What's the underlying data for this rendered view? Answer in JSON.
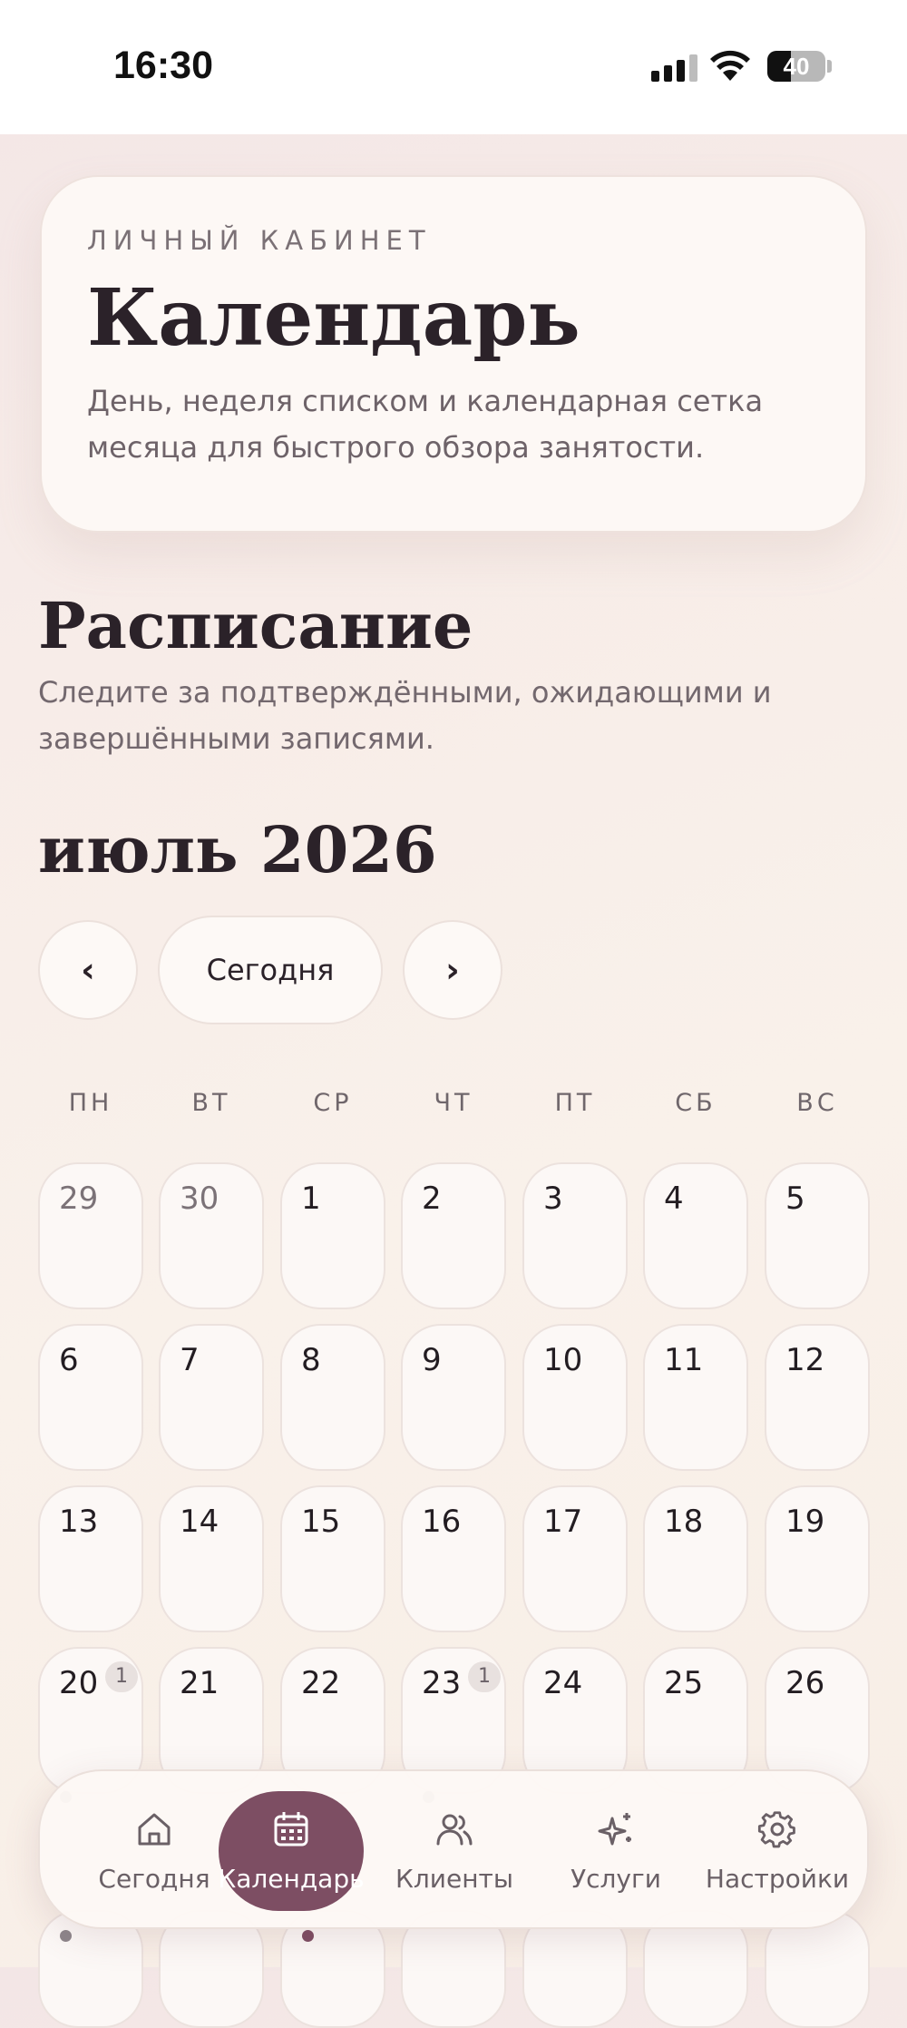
{
  "status_bar": {
    "time": "16:30",
    "battery": "40"
  },
  "hero": {
    "eyebrow": "ЛИЧНЫЙ КАБИНЕТ",
    "title": "Календарь",
    "description": "День, неделя списком и календарная сетка месяца для быстрого обзора занятости."
  },
  "schedule": {
    "title": "Расписание",
    "description": "Следите за подтверждёнными, ожидающими и завершёнными записями."
  },
  "calendar": {
    "month_label": "июль 2026",
    "prev_label": "‹",
    "today_label": "Сегодня",
    "next_label": "›",
    "weekdays": [
      "ПН",
      "ВТ",
      "СР",
      "ЧТ",
      "ПТ",
      "СБ",
      "ВС"
    ],
    "days": [
      {
        "n": "29",
        "other": true
      },
      {
        "n": "30",
        "other": true
      },
      {
        "n": "1"
      },
      {
        "n": "2"
      },
      {
        "n": "3"
      },
      {
        "n": "4"
      },
      {
        "n": "5"
      },
      {
        "n": "6"
      },
      {
        "n": "7"
      },
      {
        "n": "8"
      },
      {
        "n": "9"
      },
      {
        "n": "10"
      },
      {
        "n": "11"
      },
      {
        "n": "12"
      },
      {
        "n": "13"
      },
      {
        "n": "14"
      },
      {
        "n": "15"
      },
      {
        "n": "16"
      },
      {
        "n": "17"
      },
      {
        "n": "18"
      },
      {
        "n": "19"
      },
      {
        "n": "20",
        "badge": "1",
        "dot": true
      },
      {
        "n": "21"
      },
      {
        "n": "22"
      },
      {
        "n": "23",
        "badge": "1",
        "dot": true
      },
      {
        "n": "24"
      },
      {
        "n": "25"
      },
      {
        "n": "26"
      }
    ]
  },
  "tabbar": {
    "items": [
      {
        "label": "Сегодня",
        "icon": "home-icon",
        "active": false
      },
      {
        "label": "Календарь",
        "icon": "calendar-icon",
        "active": true
      },
      {
        "label": "Клиенты",
        "icon": "users-icon",
        "active": false
      },
      {
        "label": "Услуги",
        "icon": "sparkles-icon",
        "active": false
      },
      {
        "label": "Настройки",
        "icon": "gear-icon",
        "active": false
      }
    ]
  },
  "colors": {
    "accent": "#7d4e63",
    "card": "#fcf8f6",
    "text": "#2b2229"
  }
}
